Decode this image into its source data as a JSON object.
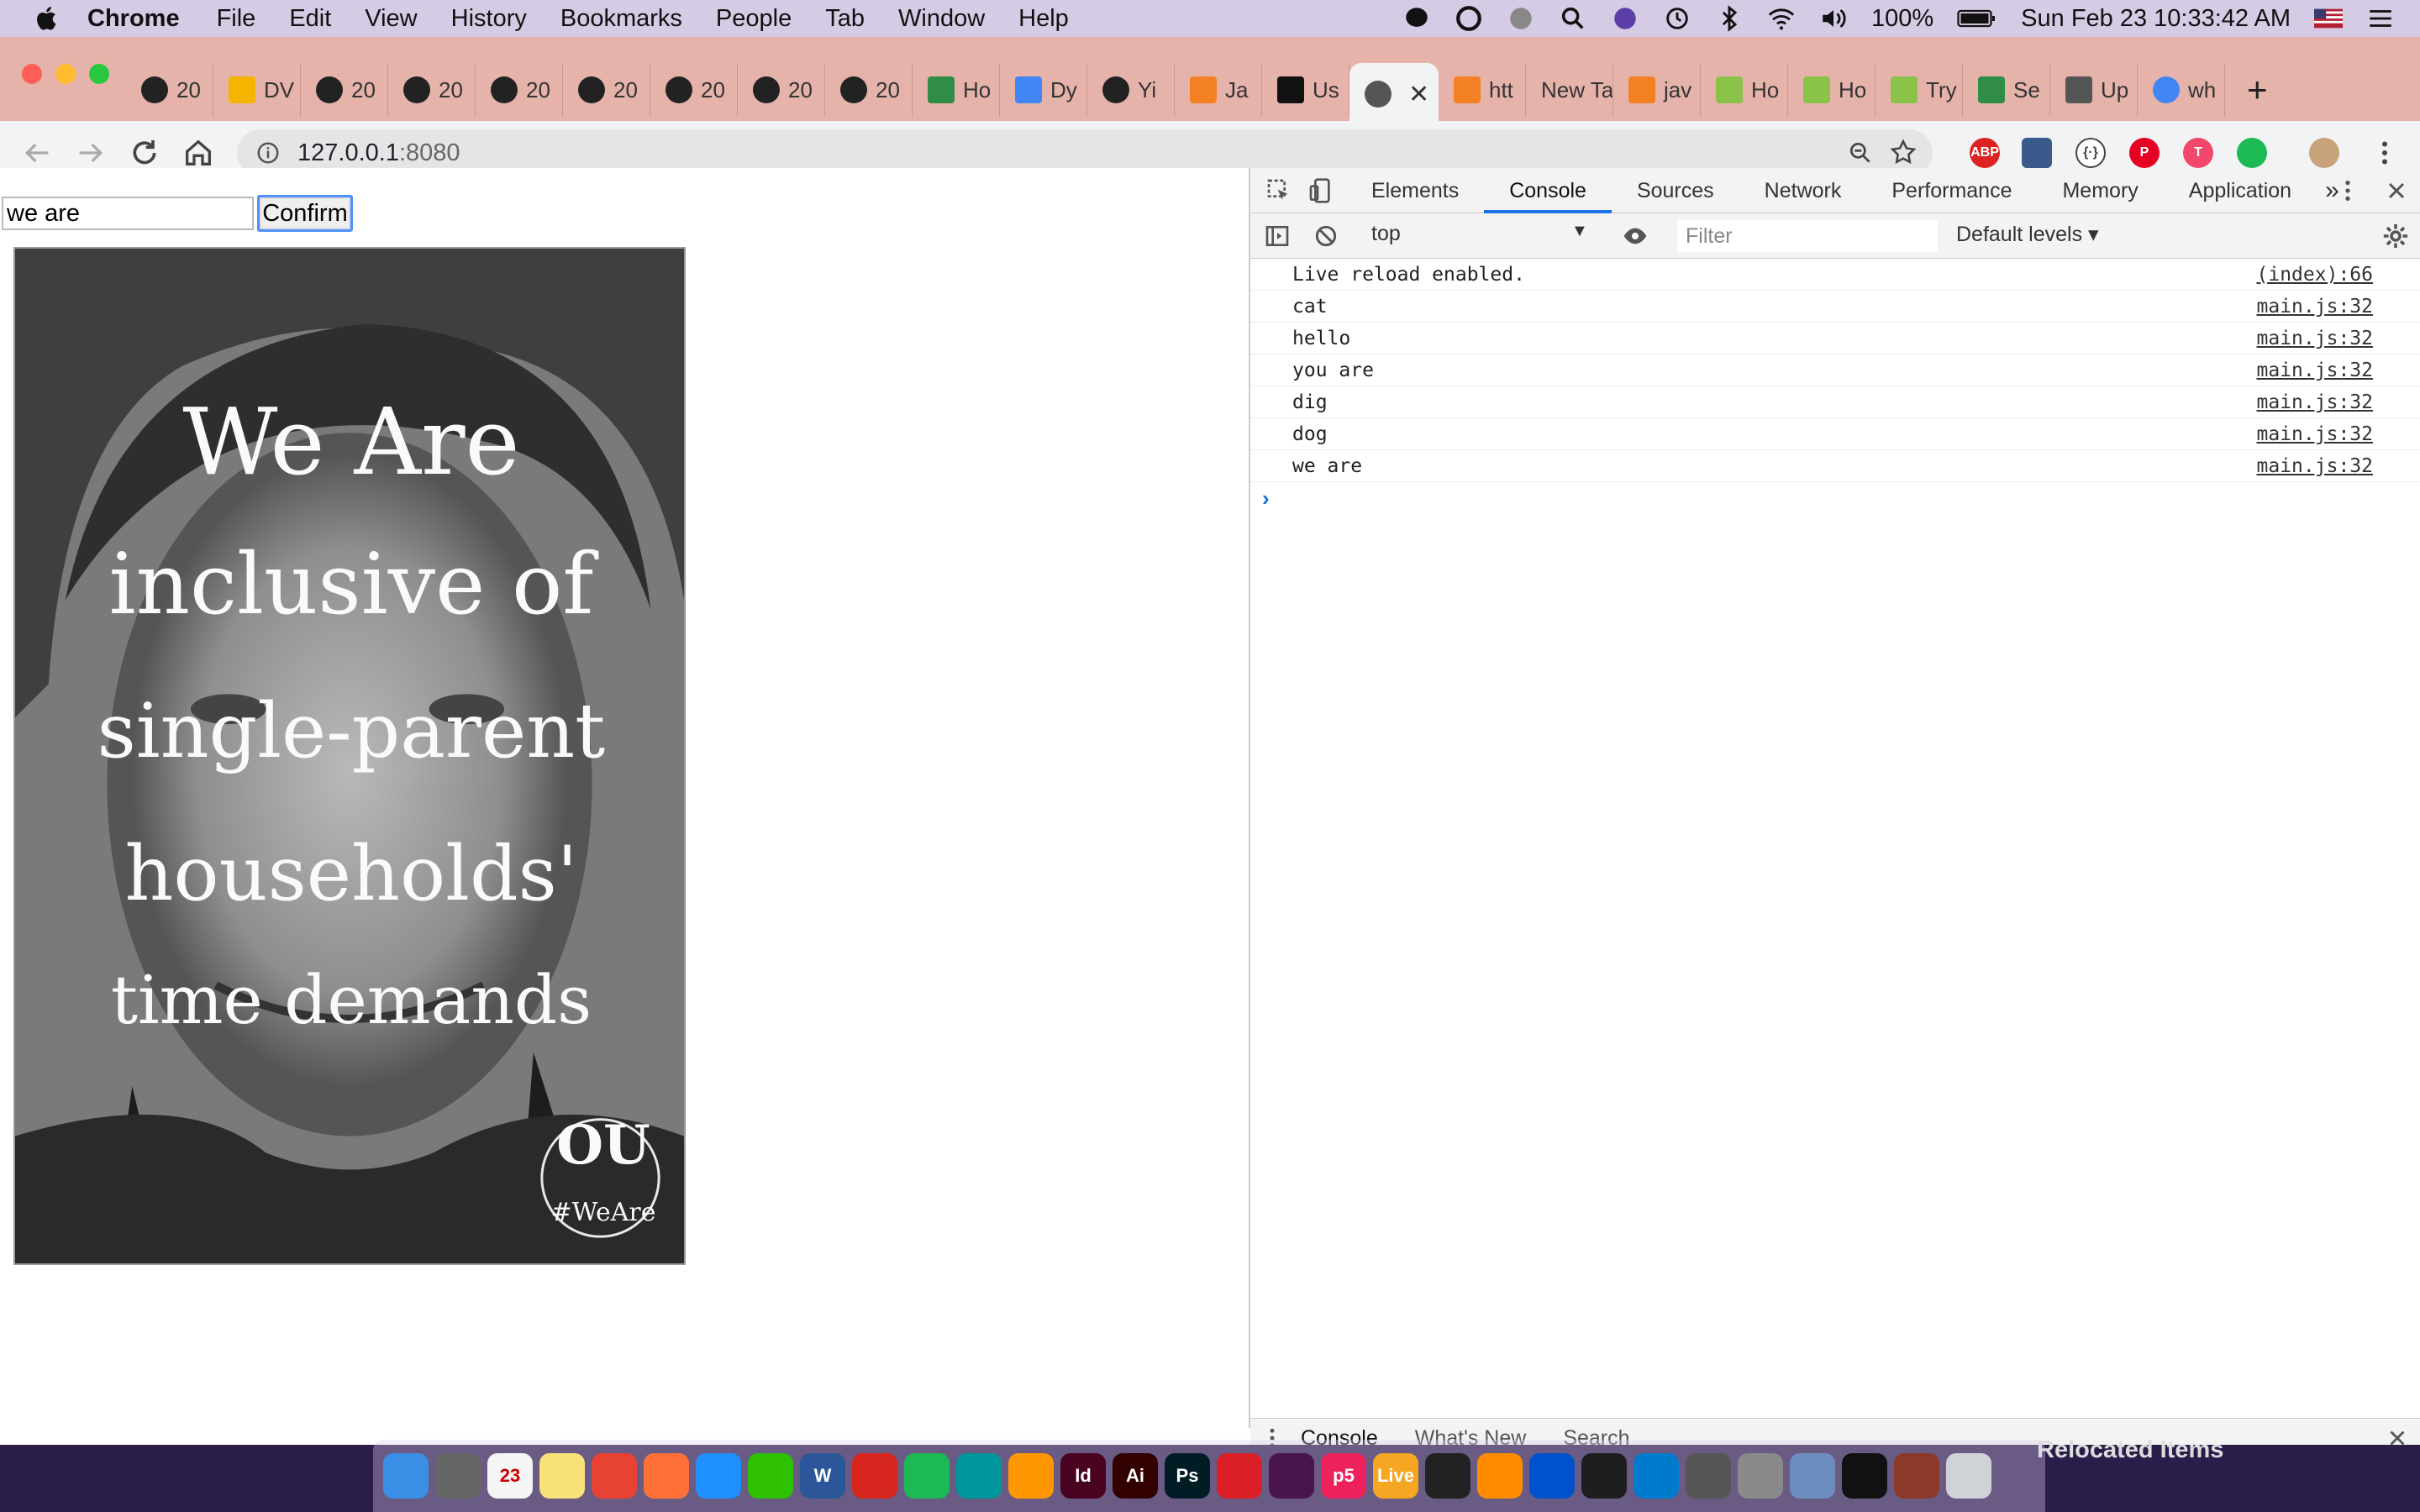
{
  "menubar": {
    "app_name": "Chrome",
    "menus": [
      "File",
      "Edit",
      "View",
      "History",
      "Bookmarks",
      "People",
      "Tab",
      "Window",
      "Help"
    ],
    "battery": "100%",
    "datetime": "Sun Feb 23  10:33:42 AM"
  },
  "tabs": [
    {
      "icon": "github-icon",
      "label": "20"
    },
    {
      "icon": "slides-icon",
      "label": "DV"
    },
    {
      "icon": "github-icon",
      "label": "20"
    },
    {
      "icon": "github-icon",
      "label": "20"
    },
    {
      "icon": "github-icon",
      "label": "20"
    },
    {
      "icon": "github-icon",
      "label": "20"
    },
    {
      "icon": "github-icon",
      "label": "20"
    },
    {
      "icon": "github-icon",
      "label": "20"
    },
    {
      "icon": "github-icon",
      "label": "20"
    },
    {
      "icon": "gfg-icon",
      "label": "Ho"
    },
    {
      "icon": "docs-icon",
      "label": "Dy"
    },
    {
      "icon": "github-icon",
      "label": "Yi"
    },
    {
      "icon": "stackoverflow-icon",
      "label": "Ja"
    },
    {
      "icon": "bulb-icon",
      "label": "Us"
    },
    {
      "icon": "globe-icon",
      "label": "",
      "active": true
    },
    {
      "icon": "stackoverflow-icon",
      "label": "htt"
    },
    {
      "icon": "",
      "label": "New Ta"
    },
    {
      "icon": "stackoverflow-icon",
      "label": "jav"
    },
    {
      "icon": "w3-icon",
      "label": "Ho"
    },
    {
      "icon": "w3-icon",
      "label": "Ho"
    },
    {
      "icon": "w3-icon",
      "label": "Try"
    },
    {
      "icon": "gfg-icon",
      "label": "Se"
    },
    {
      "icon": "anchor-icon",
      "label": "Up"
    },
    {
      "icon": "google-icon",
      "label": "wh"
    }
  ],
  "omnibox": {
    "host": "127.0.0.1",
    "port": ":8080"
  },
  "page": {
    "input_value": "we are",
    "confirm_label": "Confirm",
    "poster_text_lines": [
      "We Are",
      "inclusive of",
      "single-parent",
      "households'",
      "time demands"
    ],
    "poster_hashtag": "#WeAre",
    "poster_logo": "OU"
  },
  "devtools": {
    "tabs": [
      "Elements",
      "Console",
      "Sources",
      "Network",
      "Performance",
      "Memory",
      "Application"
    ],
    "active_tab": "Console",
    "more_tabs": "»",
    "context": "top",
    "filter_placeholder": "Filter",
    "levels": "Default levels ▾",
    "logs": [
      {
        "msg": "Live reload enabled.",
        "src": "(index):66"
      },
      {
        "msg": "cat",
        "src": "main.js:32"
      },
      {
        "msg": "hello",
        "src": "main.js:32"
      },
      {
        "msg": "you are",
        "src": "main.js:32"
      },
      {
        "msg": "dig",
        "src": "main.js:32"
      },
      {
        "msg": "dog",
        "src": "main.js:32"
      },
      {
        "msg": "we are",
        "src": "main.js:32"
      }
    ],
    "prompt": "›",
    "drawer_tabs": [
      "Console",
      "What's New",
      "Search"
    ]
  },
  "dock": {
    "apps": [
      {
        "name": "finder",
        "label": "",
        "color": "#3a8ee6"
      },
      {
        "name": "launchpad",
        "label": "",
        "color": "#666"
      },
      {
        "name": "calendar",
        "label": "23",
        "color": "#f5f5f5"
      },
      {
        "name": "notes",
        "label": "",
        "color": "#f7e27a"
      },
      {
        "name": "chrome",
        "label": "",
        "color": "#e84235"
      },
      {
        "name": "firefox",
        "label": "",
        "color": "#ff7139"
      },
      {
        "name": "safari",
        "label": "",
        "color": "#1e90ff"
      },
      {
        "name": "wechat",
        "label": "",
        "color": "#2dc100"
      },
      {
        "name": "word",
        "label": "W",
        "color": "#2b579a"
      },
      {
        "name": "acrobat",
        "label": "",
        "color": "#d7261e"
      },
      {
        "name": "spotify",
        "label": "",
        "color": "#1db954"
      },
      {
        "name": "arduino",
        "label": "",
        "color": "#00979c"
      },
      {
        "name": "sublime",
        "label": "",
        "color": "#ff9800"
      },
      {
        "name": "indesign",
        "label": "Id",
        "color": "#49021f"
      },
      {
        "name": "illustrator",
        "label": "Ai",
        "color": "#330000"
      },
      {
        "name": "photoshop",
        "label": "Ps",
        "color": "#001d26"
      },
      {
        "name": "creative-cloud",
        "label": "",
        "color": "#da1f26"
      },
      {
        "name": "slack",
        "label": "",
        "color": "#4a154b"
      },
      {
        "name": "p5",
        "label": "p5",
        "color": "#ed225d"
      },
      {
        "name": "live",
        "label": "Live",
        "color": "#f5a623"
      },
      {
        "name": "terminal-app",
        "label": "",
        "color": "#222"
      },
      {
        "name": "books",
        "label": "",
        "color": "#ff8c00"
      },
      {
        "name": "sourcetree",
        "label": "",
        "color": "#0052cc"
      },
      {
        "name": "figma",
        "label": "",
        "color": "#1e1e1e"
      },
      {
        "name": "vscode",
        "label": "",
        "color": "#007acc"
      },
      {
        "name": "github-desktop",
        "label": "",
        "color": "#555"
      },
      {
        "name": "system-prefs",
        "label": "",
        "color": "#8a8a8a"
      },
      {
        "name": "preview",
        "label": "",
        "color": "#6c8ebf"
      },
      {
        "name": "terminal",
        "label": "",
        "color": "#111"
      },
      {
        "name": "node-window",
        "label": "",
        "color": "#8b3a2a"
      },
      {
        "name": "trash",
        "label": "",
        "color": "#cfd3d8"
      }
    ],
    "relocated_label": "Relocated Items"
  }
}
